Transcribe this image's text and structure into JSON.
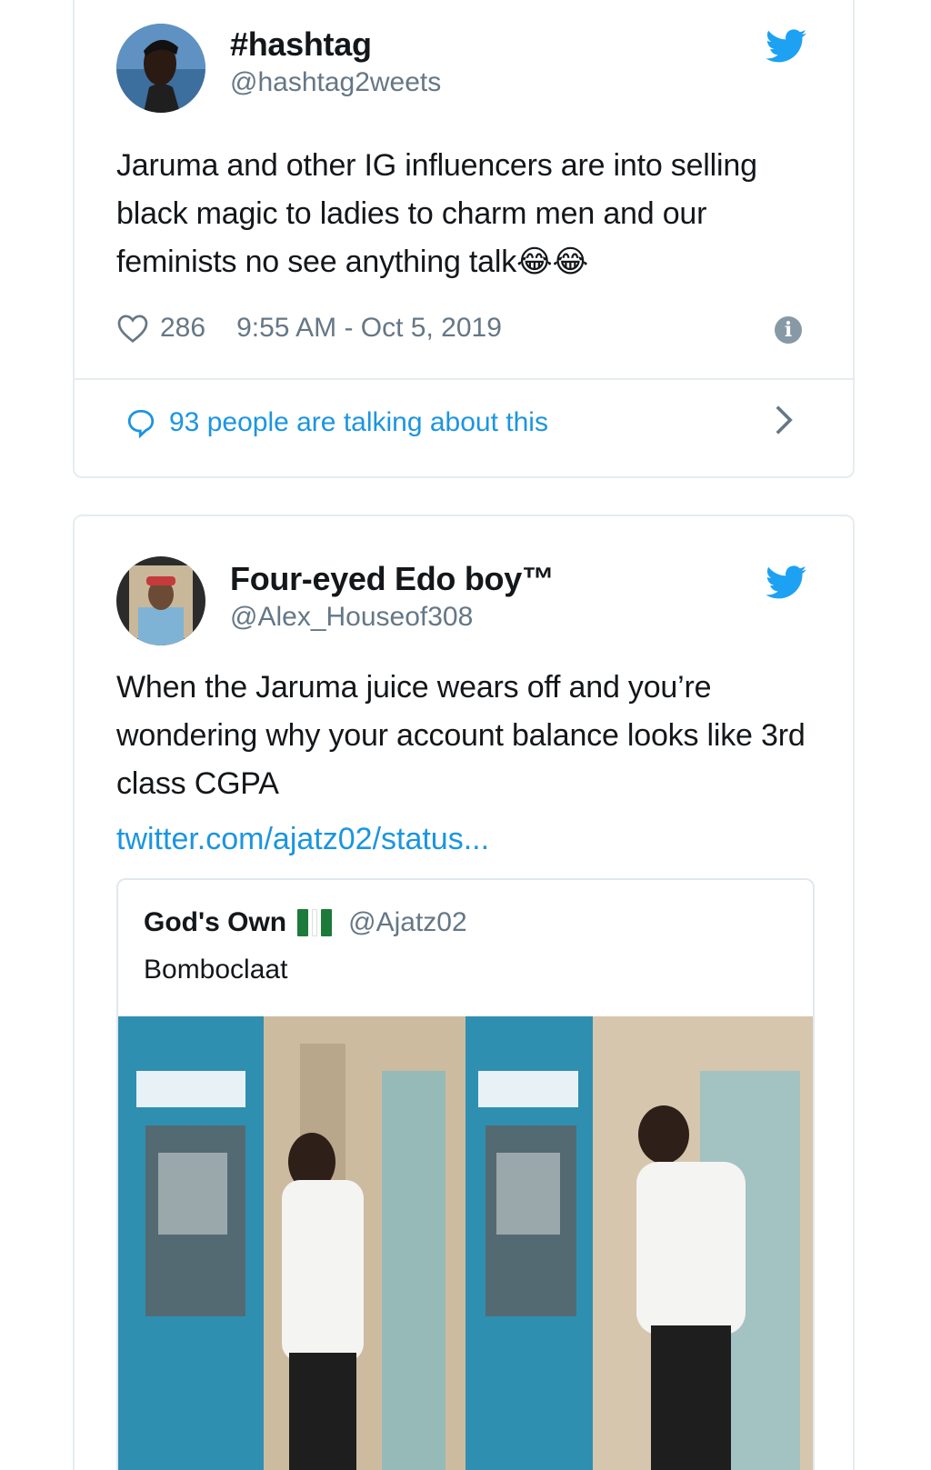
{
  "tweet1": {
    "name": "#hashtag",
    "handle": "@hashtag2weets",
    "text": "Jaruma and other IG influencers are into selling black magic to ladies to charm men and our feminists no see anything talk😂😂",
    "likes": "286",
    "timestamp": "9:55 AM - Oct 5, 2019",
    "talking": "93 people are talking about this",
    "icons": [
      "twitter-bird-icon",
      "heart-icon",
      "info-icon",
      "speech-bubble-icon",
      "chevron-right-icon"
    ]
  },
  "tweet2": {
    "name": "Four-eyed Edo boy™",
    "handle": "@Alex_Houseof308",
    "text": "When the Jaruma juice wears off and you’re wondering why your account balance looks like 3rd class CGPA",
    "link": "twitter.com/ajatz02/status...",
    "quote": {
      "name": "God's Own",
      "flag": "nigeria-flag",
      "handle": "@Ajatz02",
      "text": "Bomboclaat"
    }
  },
  "colors": {
    "twitter_blue": "#1da1f2",
    "link_blue": "#1b95e0",
    "secondary_text": "#657786",
    "border": "#e6ecf0"
  }
}
